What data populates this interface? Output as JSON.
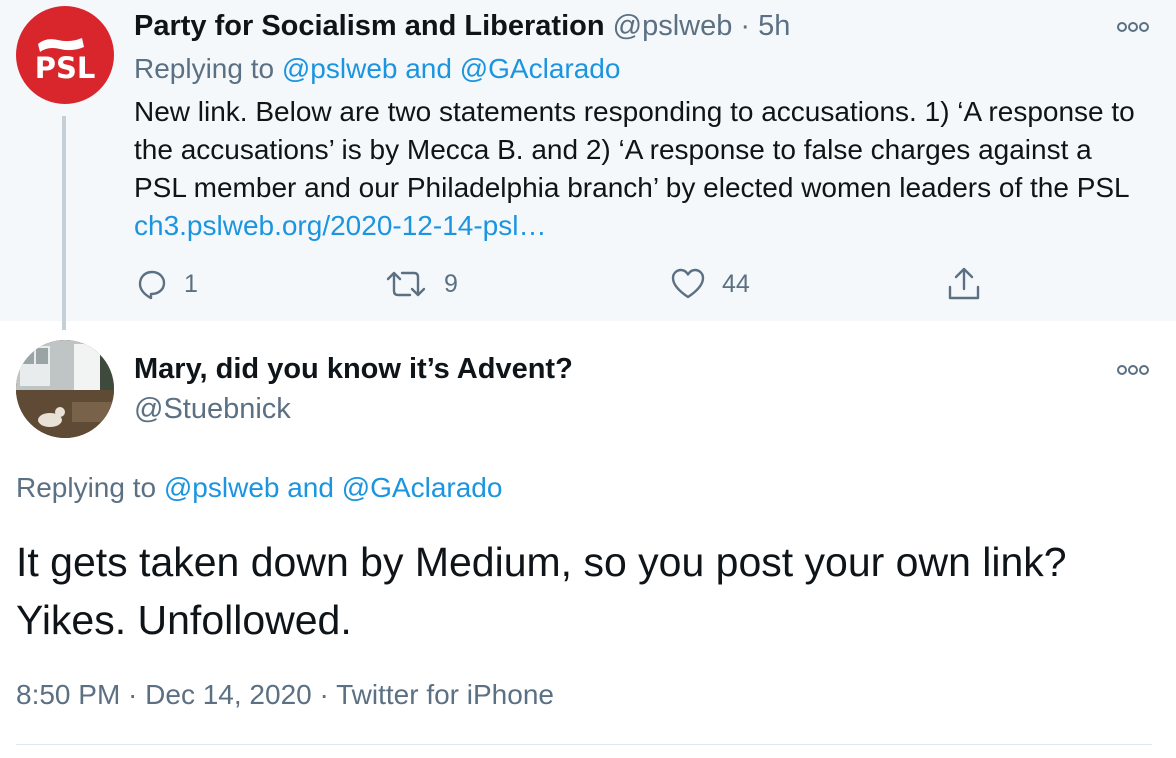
{
  "parent_tweet": {
    "avatar_text": "PSL",
    "author_name": "Party for Socialism and Liberation",
    "handle": "@pslweb",
    "separator": "·",
    "time": "5h",
    "replying_prefix": "Replying to",
    "replying_to": "@pslweb and @GAclarado",
    "body": "New link. Below are two statements responding to accusations. 1) ‘A response to the accusations’ is by Mecca B. and 2) ‘A response to false charges against a PSL member and our Philadelphia branch’ by elected women leaders of the PSL",
    "link": "ch3.pslweb.org/2020-12-14-psl…",
    "actions": {
      "reply_count": "1",
      "retweet_count": "9",
      "like_count": "44"
    },
    "icons": [
      "reply-icon",
      "retweet-icon",
      "like-icon",
      "share-icon",
      "more-icon"
    ]
  },
  "reply_tweet": {
    "author_name": "Mary, did you know it’s Advent?",
    "handle": "@Stuebnick",
    "replying_prefix": "Replying to",
    "replying_to": "@pslweb and @GAclarado",
    "body_line1": "It gets taken down by Medium, so you post your own link?",
    "body_line2": "Yikes. Unfollowed.",
    "meta": "8:50 PM · Dec 14, 2020 · Twitter for iPhone"
  },
  "colors": {
    "link": "#1b95e0",
    "secondary_text": "#5b7083",
    "parent_background": "#f5f8fa",
    "psl_red": "#d9262c"
  }
}
